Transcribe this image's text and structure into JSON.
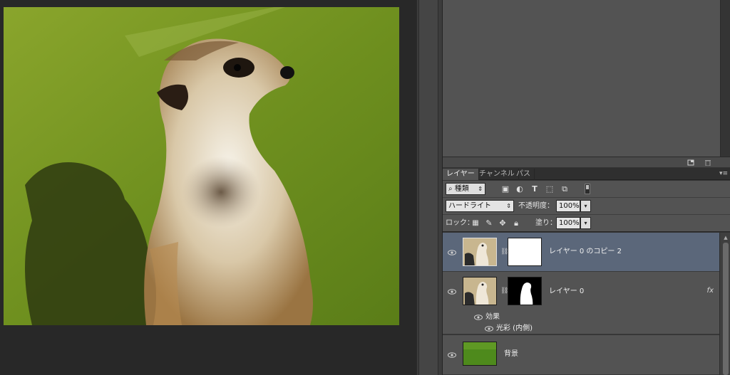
{
  "tabs": [
    {
      "label": "レイヤー",
      "active": true
    },
    {
      "label": "チャンネル",
      "active": false
    },
    {
      "label": "パス",
      "active": false
    }
  ],
  "filter": {
    "kind_label": "種類"
  },
  "blend": {
    "mode": "ハードライト",
    "opacity_label": "不透明度：",
    "opacity_value": "100%"
  },
  "lock": {
    "label": "ロック：",
    "fill_label": "塗り：",
    "fill_value": "100%"
  },
  "layers": [
    {
      "name": "レイヤー 0 のコピー 2",
      "selected": true,
      "visible": true
    },
    {
      "name": "レイヤー 0",
      "selected": false,
      "visible": true,
      "fx": "fx"
    },
    {
      "name": "背景",
      "selected": false,
      "visible": true
    }
  ],
  "effects": {
    "label": "効果",
    "items": [
      "光彩 (内側)"
    ]
  },
  "colors": {
    "panel": "#535353",
    "selected_layer": "#5b677a",
    "canvas_bg": "#282828"
  },
  "icons": [
    "eye-icon",
    "chain-icon",
    "search-icon",
    "image-filter-icon",
    "adjustment-filter-icon",
    "type-filter-icon",
    "shape-filter-icon",
    "smartobject-filter-icon",
    "lock-pixels-icon",
    "lock-paint-icon",
    "lock-move-icon",
    "lock-all-icon",
    "new-layer-icon",
    "trash-icon",
    "panel-menu-icon"
  ]
}
